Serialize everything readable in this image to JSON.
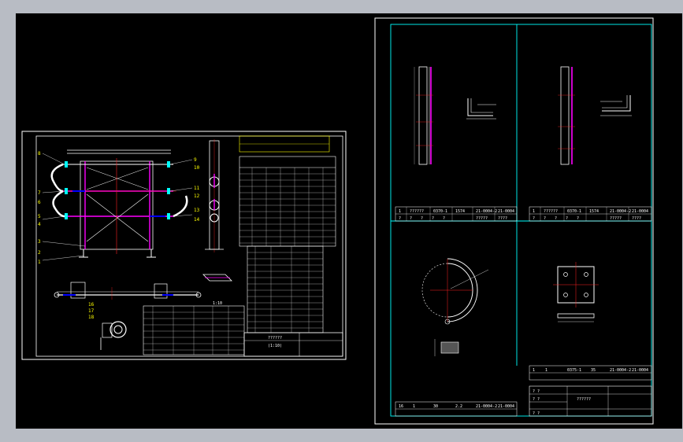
{
  "colors": {
    "background": "#000000",
    "frame": "#ffffff",
    "border_right": "#00ffff",
    "part_yellow": "#ffff00",
    "part_magenta": "#ff00ff",
    "part_red": "#ff2020",
    "part_blue": "#0000ff",
    "part_cyan": "#00ffff",
    "outer_chrome": "#b8bcc4"
  },
  "left_sheet": {
    "assembly": {
      "leader_numbers_left": [
        "8",
        "7",
        "6",
        "5",
        "4",
        "3",
        "2",
        "1"
      ],
      "leader_numbers_right": [
        "9",
        "10",
        "11",
        "12",
        "13",
        "14"
      ],
      "detail_numbers": [
        "16",
        "17",
        "18"
      ],
      "scale_note": "1:10"
    },
    "title_block": {
      "drawing_name": "??????",
      "scale": "(1:10)"
    }
  },
  "right_sheet": {
    "upper_title_row_1": [
      "1",
      "??????",
      "0370-1",
      "1574",
      "21-0004-2",
      "21-0004"
    ],
    "upper_title_row_2": [
      "?",
      "?",
      "?",
      "?",
      "?",
      "?????",
      "????"
    ],
    "lower_title_row_1": [
      "1",
      "1",
      "0375-1",
      "35",
      "21-0004-2",
      "21-0004"
    ],
    "bottom_left_row": [
      "16",
      "1",
      "30",
      "2.2",
      "21-0004-2",
      "21-0004"
    ],
    "title_block": {
      "drawing_name": "??????",
      "fields": [
        "? ?",
        "? ?",
        "? ?"
      ]
    }
  }
}
